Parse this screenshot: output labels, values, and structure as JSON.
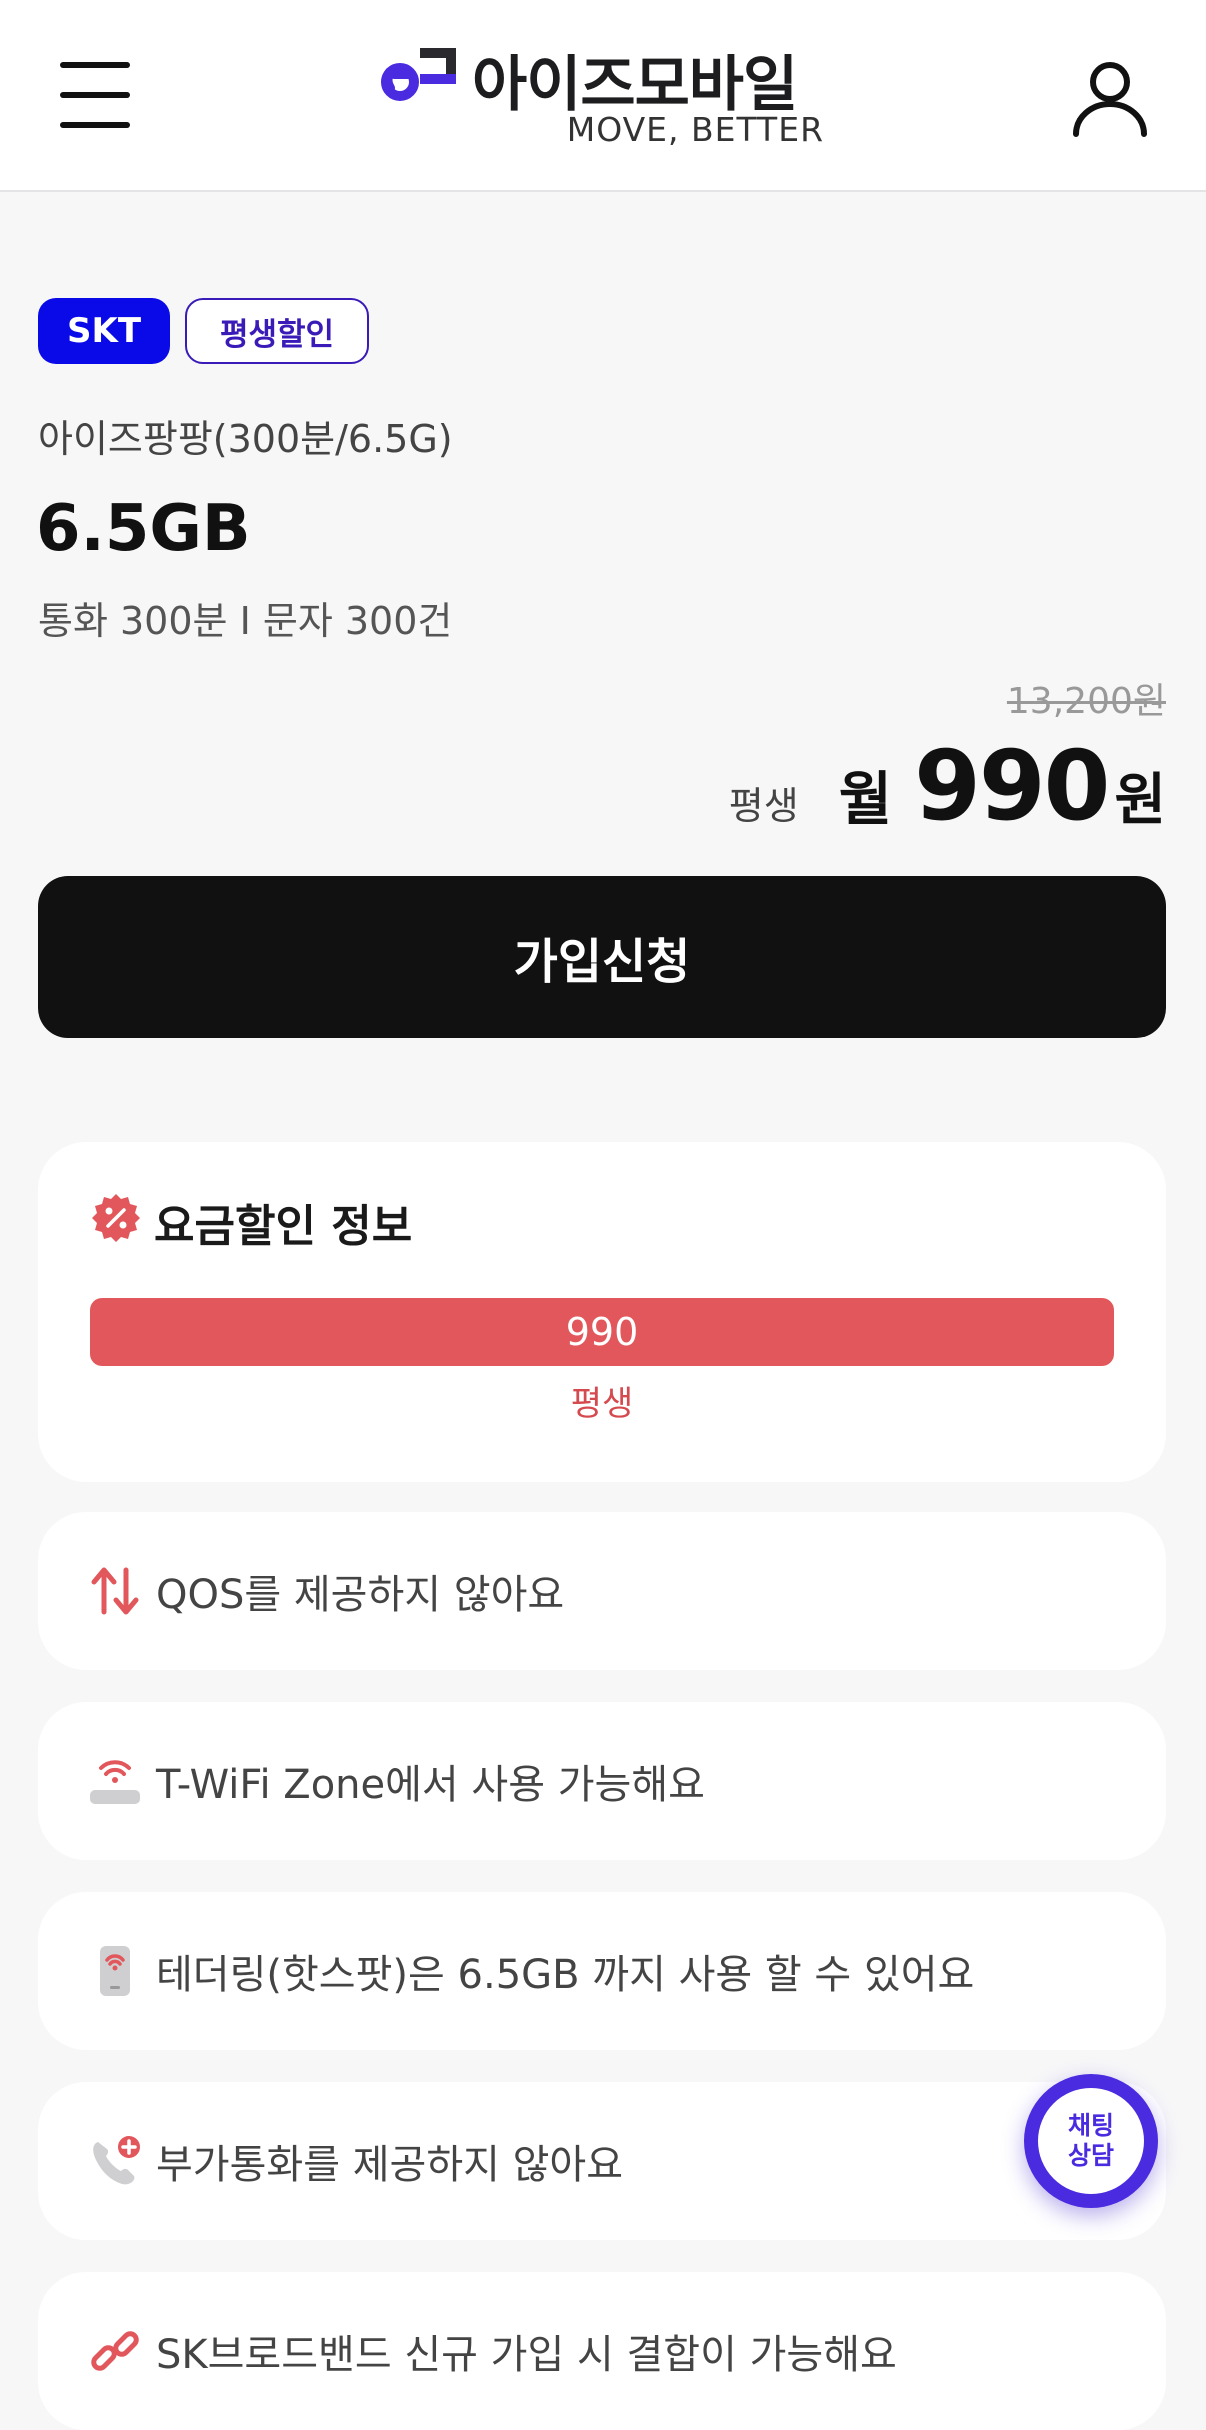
{
  "header": {
    "logo_text": "아이즈모바일",
    "logo_tagline": "MOVE, BETTER",
    "menu_icon": "hamburger-menu-icon",
    "user_icon": "user-icon"
  },
  "plan": {
    "carrier_badge": "SKT",
    "discount_badge": "평생할인",
    "name": "아이즈팡팡(300분/6.5G)",
    "data": "6.5GB",
    "voice_sms": "통화 300분 I 문자 300건",
    "original_price": "13,200원",
    "price_label": "평생",
    "price_month": "월",
    "price_value": "990",
    "price_unit": "원"
  },
  "cta": {
    "join_label": "가입신청"
  },
  "discount_info": {
    "title": "요금할인 정보",
    "title_icon": "discount-badge-icon",
    "bar_value": "990",
    "bar_label": "평생"
  },
  "features": [
    {
      "icon": "up-down-arrows-icon",
      "text": "QOS를 제공하지 않아요"
    },
    {
      "icon": "wifi-router-icon",
      "text": "T-WiFi Zone에서 사용 가능해요"
    },
    {
      "icon": "hotspot-phone-icon",
      "text": "테더링(핫스팟)은 6.5GB 까지 사용 할 수 있어요"
    },
    {
      "icon": "phone-plus-icon",
      "text": "부가통화를 제공하지 않아요"
    },
    {
      "icon": "link-icon",
      "text": "SK브로드밴드 신규 가입 시 결합이 가능해요"
    }
  ],
  "chat": {
    "line1": "채팅",
    "line2": "상담"
  },
  "colors": {
    "skt_blue": "#0a0ae8",
    "brand_purple": "#4a2be0",
    "discount_red": "#e2575b",
    "cta_black": "#111111"
  }
}
